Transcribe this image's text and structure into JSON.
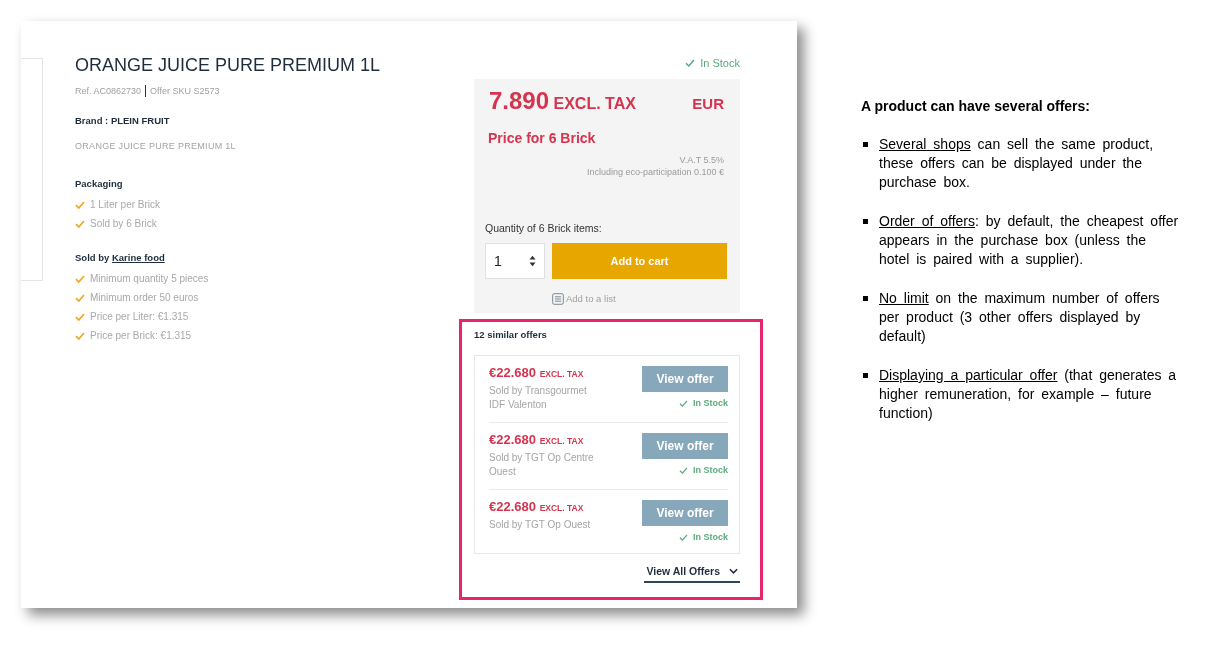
{
  "product": {
    "title": "ORANGE JUICE PURE PREMIUM 1L",
    "ref": "Ref. AC0862730",
    "offer_sku": "Offer SKU S2573",
    "brand": "Brand : PLEIN FRUIT",
    "description": "ORANGE JUICE PURE PREMIUM 1L",
    "packaging": {
      "heading": "Packaging",
      "items": [
        "1 Liter per Brick",
        "Sold by 6 Brick"
      ]
    },
    "seller": {
      "label": "Sold by",
      "link": "Karine food",
      "items": [
        "Minimum quantity 5 pieces",
        "Minimum order 50 euros",
        "Price per Liter: €1.315",
        "Price per Brick: €1.315"
      ]
    }
  },
  "purchase_box": {
    "stock": "In Stock",
    "price": "7.890",
    "price_suffix": "EXCL. TAX",
    "currency": "EUR",
    "price_for": "Price for 6 Brick",
    "vat": "V.A.T 5.5%",
    "eco_participation": "Including eco-participation 0.100 €",
    "quantity_label": "Quantity of 6 Brick items:",
    "quantity": "1",
    "add_to_cart": "Add to cart",
    "add_to_list": "Add to a list"
  },
  "similar_offers": {
    "heading": "12 similar offers",
    "offers": [
      {
        "price": "€22.680",
        "price_suffix": "EXCL. TAX",
        "seller": "Sold by Transgourmet IDF Valenton",
        "button": "View offer",
        "stock": "In Stock"
      },
      {
        "price": "€22.680",
        "price_suffix": "EXCL. TAX",
        "seller": "Sold by TGT Op Centre Ouest",
        "button": "View offer",
        "stock": "In Stock"
      },
      {
        "price": "€22.680",
        "price_suffix": "EXCL. TAX",
        "seller": "Sold by TGT Op Ouest",
        "button": "View offer",
        "stock": "In Stock"
      }
    ],
    "view_all": "View All Offers"
  },
  "notes": {
    "heading": "A product can have several offers:",
    "items": [
      {
        "underlined": "Several shops",
        "rest": " can sell the same product, these offers can be displayed under the purchase box."
      },
      {
        "underlined": "Order of offers",
        "rest": ": by default, the cheapest offer appears in the purchase box (unless the hotel is paired with a supplier)."
      },
      {
        "underlined": "No limit",
        "rest": " on the maximum number of offers per product (3 other offers displayed by default)"
      },
      {
        "underlined": "Displaying a particular offer",
        "rest": " (that generates a higher remuneration, for example – future function)"
      }
    ]
  }
}
